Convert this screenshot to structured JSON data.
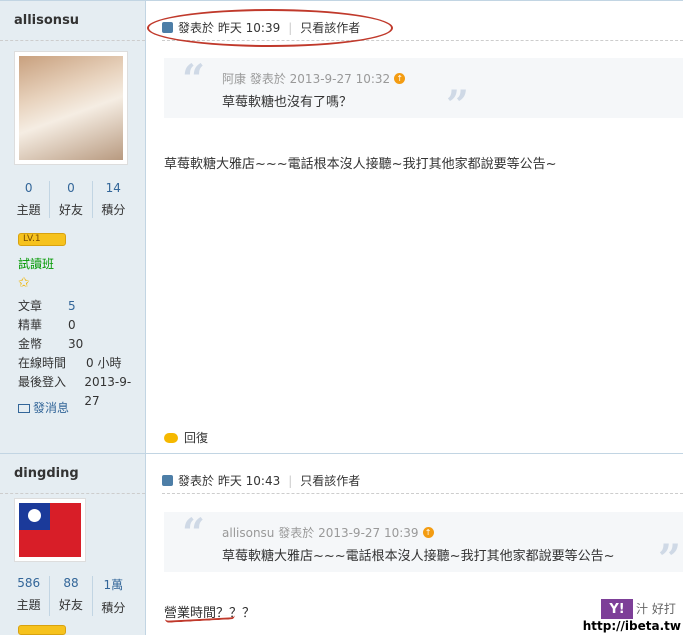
{
  "post1": {
    "username": "allisonsu",
    "stats": [
      {
        "num": "0",
        "label": "主題"
      },
      {
        "num": "0",
        "label": "好友"
      },
      {
        "num": "14",
        "label": "積分"
      }
    ],
    "badge": "LV.1",
    "group": "試讀班",
    "info": [
      {
        "key": "文章",
        "value": "5",
        "link": true
      },
      {
        "key": "精華",
        "value": "0",
        "link": false
      },
      {
        "key": "金幣",
        "value": "30",
        "link": false
      },
      {
        "key": "在線時間",
        "value": "0 小時",
        "link": false
      },
      {
        "key": "最後登入",
        "value": "2013-9-27",
        "link": false
      }
    ],
    "pm_label": "發消息",
    "posted": "發表於 昨天 10:39",
    "only_author": "只看該作者",
    "quote": {
      "author": "阿康",
      "meta": "發表於 2013-9-27 10:32",
      "text": "草莓軟糖也沒有了嗎？"
    },
    "body": "草莓軟糖大雅店~~~電話根本沒人接聽~我打其他家都說要等公告~",
    "reply_label": "回復"
  },
  "post2": {
    "username": "dingding",
    "stats": [
      {
        "num": "586",
        "label": "主題"
      },
      {
        "num": "88",
        "label": "好友"
      },
      {
        "num": "1萬",
        "label": "積分"
      }
    ],
    "posted": "發表於 昨天 10:43",
    "only_author": "只看該作者",
    "quote": {
      "author": "allisonsu",
      "meta": "發表於 2013-9-27 10:39",
      "text": "草莓軟糖大雅店~~~電話根本沒人接聽~我打其他家都說要等公告~"
    },
    "body": "營業時間？？？"
  },
  "watermark": {
    "logo": "Y!",
    "text": "汁 好打",
    "url": "http://ibeta.tw"
  },
  "colors": {
    "accent": "#336699",
    "annotation": "#c0392b",
    "sidebar": "#e5edf2"
  }
}
